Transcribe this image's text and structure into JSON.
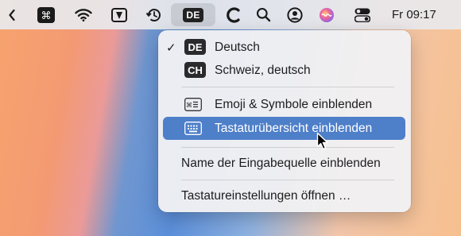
{
  "menubar": {
    "icons": [
      "chevron-left-icon",
      "command-icon",
      "wifi-icon",
      "pen-tablet-icon",
      "time-machine-icon",
      "input-source-icon",
      "cloud-icon",
      "search-icon",
      "user-icon",
      "siri-icon",
      "control-center-icon"
    ],
    "input_badge": "DE",
    "clock": "Fr 09:17"
  },
  "menu": {
    "sources": [
      {
        "badge": "DE",
        "label": "Deutsch",
        "checked": true
      },
      {
        "badge": "CH",
        "label": "Schweiz, deutsch",
        "checked": false
      }
    ],
    "emoji_label": "Emoji & Symbole einblenden",
    "viewer_label": "Tastaturübersicht einblenden",
    "show_name_label": "Name der Eingabequelle einblenden",
    "settings_label": "Tastatureinstellungen öffnen …",
    "check_mark": "✓"
  },
  "colors": {
    "highlight": "#4e7fc9",
    "menubar": "#e8e8ec"
  }
}
